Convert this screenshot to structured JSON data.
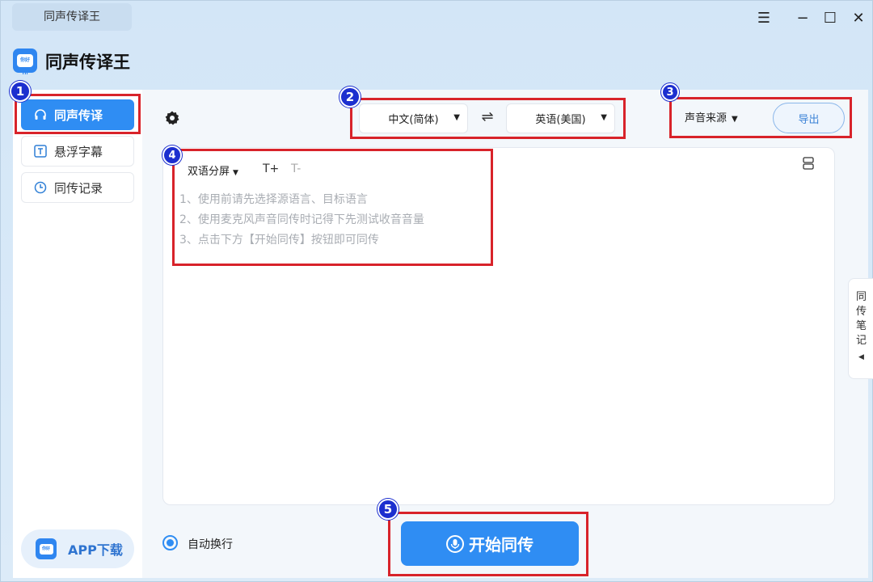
{
  "window": {
    "tab_title": "同声传译王",
    "controls": {
      "menu": "☰",
      "minimize": "−",
      "maximize": "☐",
      "close": "✕"
    }
  },
  "header": {
    "app_name": "同声传译王",
    "logo_text": "你好 Hi"
  },
  "sidebar": {
    "items": [
      {
        "label": "同声传译",
        "icon": "headphones-icon",
        "active": true
      },
      {
        "label": "悬浮字幕",
        "icon": "text-box-icon",
        "active": false
      },
      {
        "label": "同传记录",
        "icon": "clock-icon",
        "active": false
      }
    ],
    "app_download": "APP下载"
  },
  "toolbar": {
    "source_language": "中文(简体)",
    "target_language": "英语(美国)",
    "swap_symbol": "⇌",
    "sound_source": "声音来源",
    "export_label": "导出"
  },
  "panel": {
    "split_mode": "双语分屏",
    "font_increase": "T+",
    "font_decrease": "T-",
    "hints": [
      "1、使用前请先选择源语言、目标语言",
      "2、使用麦克风声音同传时记得下先测试收音音量",
      "3、点击下方【开始同传】按钮即可同传"
    ]
  },
  "side_notes": {
    "label": "同传笔记"
  },
  "footer": {
    "auto_wrap_label": "自动换行",
    "start_button": "开始同传"
  },
  "annotations": [
    "1",
    "2",
    "3",
    "4",
    "5"
  ],
  "colors": {
    "accent": "#2f8df3",
    "annotation_box": "#d8232a",
    "badge": "#1c2fcf"
  }
}
